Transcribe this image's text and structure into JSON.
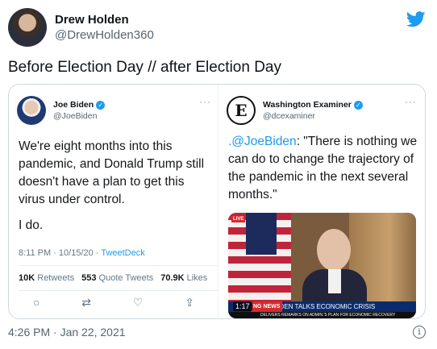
{
  "author": {
    "name": "Drew Holden",
    "handle": "@DrewHolden360"
  },
  "tweet_text": "Before Election Day // after Election Day",
  "left_tweet": {
    "name": "Joe Biden",
    "handle": "@JoeBiden",
    "verified": "✓",
    "more": "···",
    "body_p1": "We're eight months into this pandemic, and Donald Trump still doesn't have a plan to get this virus under control.",
    "body_p2": "I do.",
    "meta_time": "8:11 PM · 10/15/20 · ",
    "meta_client": "TweetDeck",
    "retweets_count": "10K",
    "retweets_label": "Retweets",
    "quote_count": "553",
    "quote_label": "Quote Tweets",
    "likes_count": "70.9K",
    "likes_label": "Likes",
    "icons": {
      "reply": "○",
      "retweet": "⇄",
      "like": "♡",
      "share": "⇪"
    }
  },
  "right_tweet": {
    "name": "Washington Examiner",
    "handle": "@dcexaminer",
    "logo_letter": "E",
    "verified": "✓",
    "more": "···",
    "mention": ".@JoeBiden",
    "quote": ": \"There is nothing we can do to change the trajectory of the pandemic in the next several months.\"",
    "video": {
      "live": "LIVE",
      "duration": "1:17",
      "network_tag": "NG NEWS",
      "headline": "BIDEN TALKS ECONOMIC CRISIS",
      "subline": "DELIVERS REMARKS ON ADMIN.'S PLAN FOR ECONOMIC RECOVERY"
    }
  },
  "footer": {
    "timestamp": "4:26 PM · Jan 22, 2021",
    "info_icon": "i"
  }
}
